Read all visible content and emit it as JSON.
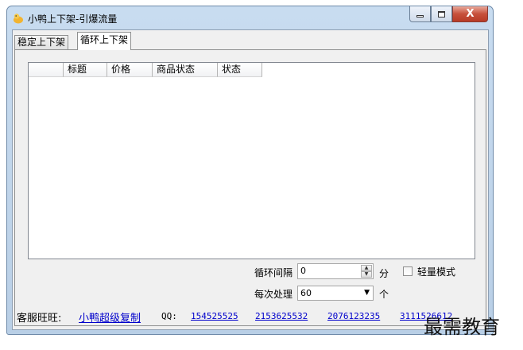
{
  "window": {
    "title": "小鸭上下架-引爆流量",
    "close_glyph": "X"
  },
  "tabs": [
    {
      "label": "稳定上下架",
      "active": false
    },
    {
      "label": "循环上下架",
      "active": true
    }
  ],
  "list": {
    "columns": [
      "",
      "标题",
      "价格",
      "商品状态",
      "状态"
    ],
    "rows": []
  },
  "controls": {
    "interval_label": "循环间隔",
    "interval_value": "0",
    "interval_unit": "分",
    "light_mode_label": "轻量模式",
    "light_mode_checked": false,
    "batch_label": "每次处理",
    "batch_value": "60",
    "batch_unit": "个"
  },
  "footer": {
    "service_label": "客服旺旺:",
    "service_link": "小鸭超级复制",
    "qq_label": "QQ:",
    "qq_numbers": [
      "154525525",
      "2153625532",
      "2076123235",
      "3111526612"
    ]
  },
  "watermark": "最需教育",
  "colors": {
    "link": "#0000cc",
    "close_button": "#c7503b",
    "window_frame": "#b9cfe6"
  }
}
